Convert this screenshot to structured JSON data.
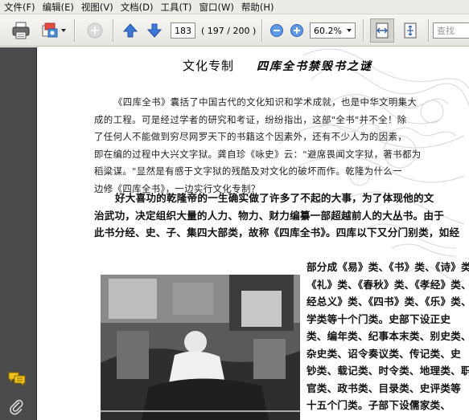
{
  "menu": [
    "文件(F)",
    "编辑(E)",
    "视图(V)",
    "文档(D)",
    "工具(T)",
    "窗口(W)",
    "帮助(H)"
  ],
  "toolbar": {
    "page_current": "183",
    "page_total": "( 197 / 200 )",
    "zoom": "60.2%",
    "search_placeholder": "查找"
  },
  "document": {
    "section": "文化专制",
    "title": "四库全书禁毁书之谜",
    "abstract": [
      "《四库全书》囊括了中国古代的文化知识和学术成就，也是中华文明集大",
      "成的工程。可是经过学者的研究和考证，纷纷指出，这部\"全书\"并不全！除",
      "了任何人不能做到穷尽网罗天下的书籍这个因素外，还有不少人为的因素，",
      "即在编的过程中大兴文字狱。龚自珍《咏史》云：\"避席畏闻文字狱，著书都为",
      "稻粱谋。\"显然是有感于文字狱的残酷及对文化的破坏而作。乾隆为什么一",
      "边修《四库全书》，一边实行文化专制？"
    ],
    "body_full": [
      "好大喜功的乾隆帝的一生确实做了许多了不起的大事，为了体现他的文",
      "治武功，决定组织大量的人力、物力、财力编纂一部超越前人的大丛书。由于",
      "此书分经、史、子、集四大部类，故称《四库全书》。四库以下又分门别类，如经"
    ],
    "body_right": [
      "部分成《易》类、《书》类、《诗》类、",
      "《礼》类、《春秋》类、《孝经》类、《五",
      "经总义》类、《四书》类、《乐》类、小",
      "学类等十个门类。史部下设正史",
      "类、编年类、纪事本末类、别史类、",
      "杂史类、诏令奏议类、传记类、史",
      "钞类、载记类、时令类、地理类、职",
      "官类、政书类、目录类、史评类等",
      "十五个门类。子部下设儒家类、"
    ]
  },
  "colors": {
    "toolbar_bg": "#e6e5e0",
    "left_panel": "#4a4a4a",
    "nav_arrow": "#3b78d8",
    "comment_icon": "#f2c21b"
  },
  "icons": [
    "print-icon",
    "scanner-icon",
    "share-icon",
    "prev-page-icon",
    "next-page-icon",
    "zoom-out-icon",
    "zoom-in-icon",
    "fit-width-icon",
    "fit-page-icon",
    "comment-icon",
    "attachment-icon"
  ]
}
